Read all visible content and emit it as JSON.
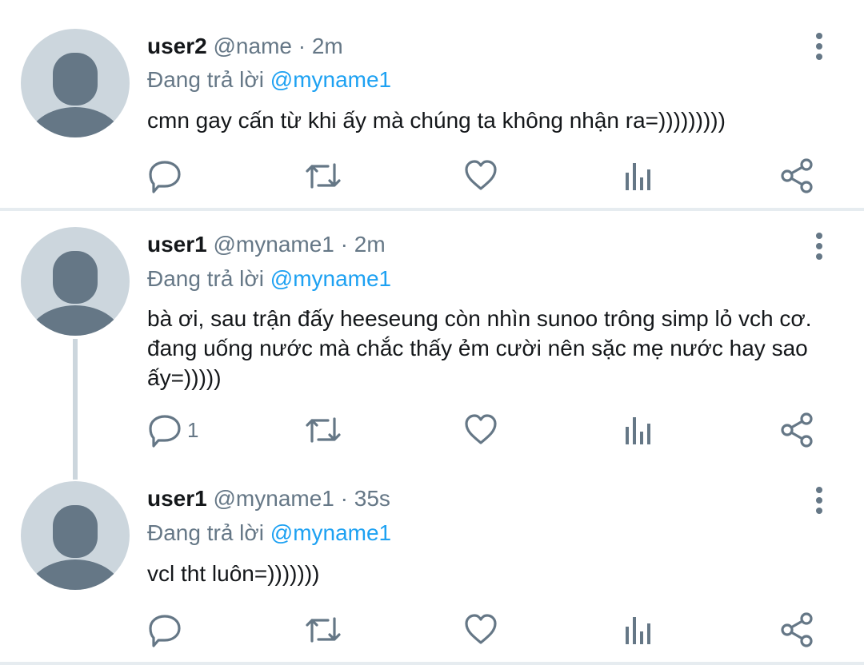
{
  "tweets": [
    {
      "name": "user2",
      "handle": "@name",
      "time": "2m",
      "replying_prefix": "Đang trả lời",
      "replying_to": "@myname1",
      "text": "cmn gay cấn từ khi ấy mà chúng ta không nhận ra=)))))))))",
      "reply_count": ""
    },
    {
      "name": "user1",
      "handle": "@myname1",
      "time": "2m",
      "replying_prefix": "Đang trả lời",
      "replying_to": "@myname1",
      "text": "bà ơi, sau trận đấy heeseung còn nhìn sunoo trông simp lỏ vch cơ. đang uống nước mà chắc thấy ẻm cười nên sặc mẹ nước hay sao ấy=)))))",
      "reply_count": "1"
    },
    {
      "name": "user1",
      "handle": "@myname1",
      "time": "35s",
      "replying_prefix": "Đang trả lời",
      "replying_to": "@myname1",
      "text": "vcl tht luôn=)))))))",
      "reply_count": ""
    }
  ],
  "separator": "·",
  "icons": [
    "reply-icon",
    "retweet-icon",
    "like-icon",
    "analytics-icon",
    "share-icon",
    "more-icon"
  ],
  "colors": {
    "primary_text": "#14171a",
    "secondary_text": "#657786",
    "mention": "#1da1f2",
    "avatar_bg": "#ccd6dd",
    "avatar_figure": "#657786",
    "icon": "#657786",
    "divider": "#e6ecf0"
  }
}
